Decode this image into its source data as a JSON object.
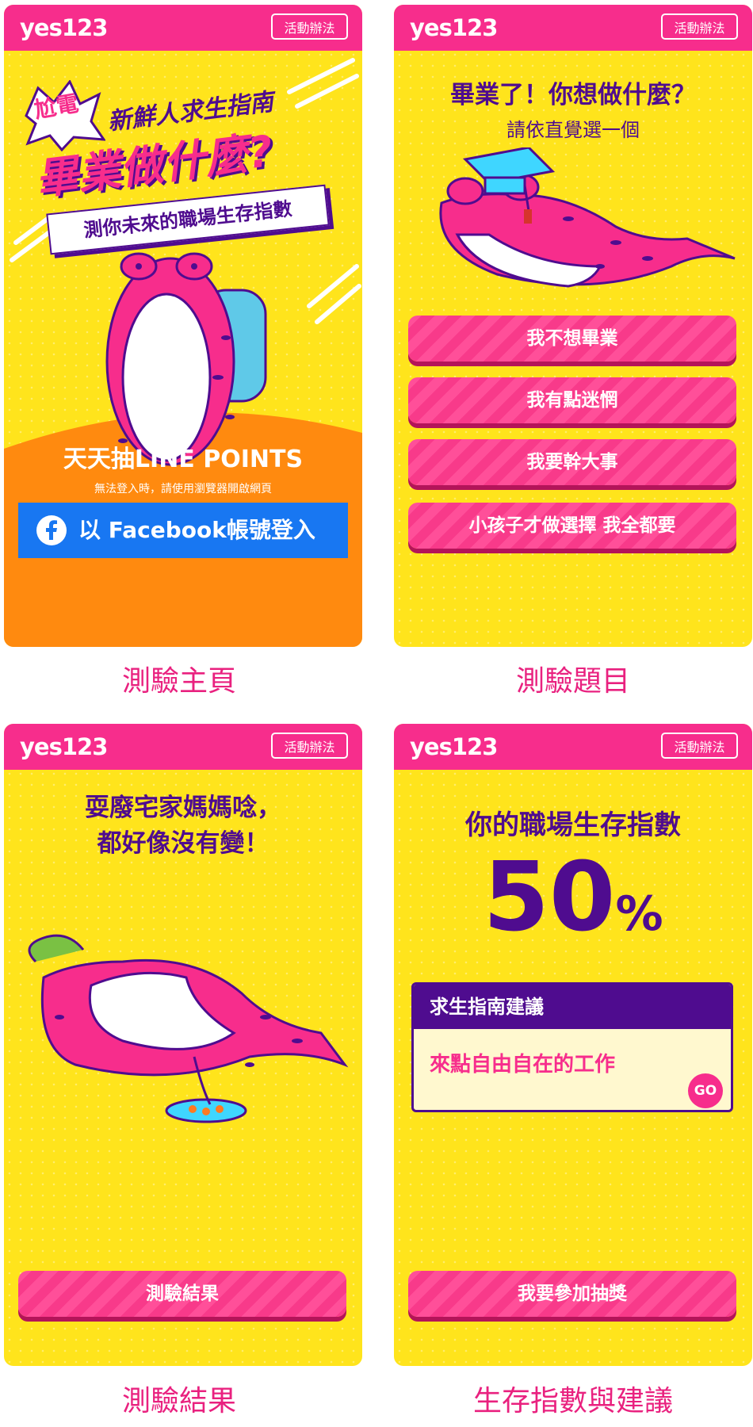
{
  "header": {
    "logo": "yes123",
    "rules_label": "活動辦法"
  },
  "home": {
    "badge_lines": [
      "尬",
      "電"
    ],
    "subtitle": "新鮮人求生指南",
    "headline": "畢業做什麼?",
    "tagline": "測你未來的職場生存指數",
    "draw_text": "天天抽LINE POINTS",
    "notice": "無法登入時，請使用瀏覽器開啟網頁",
    "fb_icon": "facebook-icon",
    "fb_label": "以 Facebook帳號登入"
  },
  "question": {
    "title": "畢業了！你想做什麼？",
    "hint": "請依直覺選一個",
    "options": [
      "我不想畢業",
      "我有點迷惘",
      "我要幹大事",
      "小孩子才做選擇 我全都要"
    ]
  },
  "result": {
    "line1": "耍廢宅家媽媽唸，",
    "line2": "都好像沒有變！",
    "button": "測驗結果"
  },
  "score": {
    "title": "你的職場生存指數",
    "value": "50",
    "unit": "%",
    "advice_header": "求生指南建議",
    "advice_text": "來點自由自在的工作",
    "go_label": "GO",
    "button": "我要參加抽獎"
  },
  "captions": [
    "測驗主頁",
    "測驗題目",
    "測驗結果",
    "生存指數與建議"
  ],
  "colors": {
    "pink": "#f72d8c",
    "yellow": "#ffe41c",
    "purple": "#4f0c8f",
    "orange": "#ff8a0f",
    "facebook": "#1877f2"
  }
}
